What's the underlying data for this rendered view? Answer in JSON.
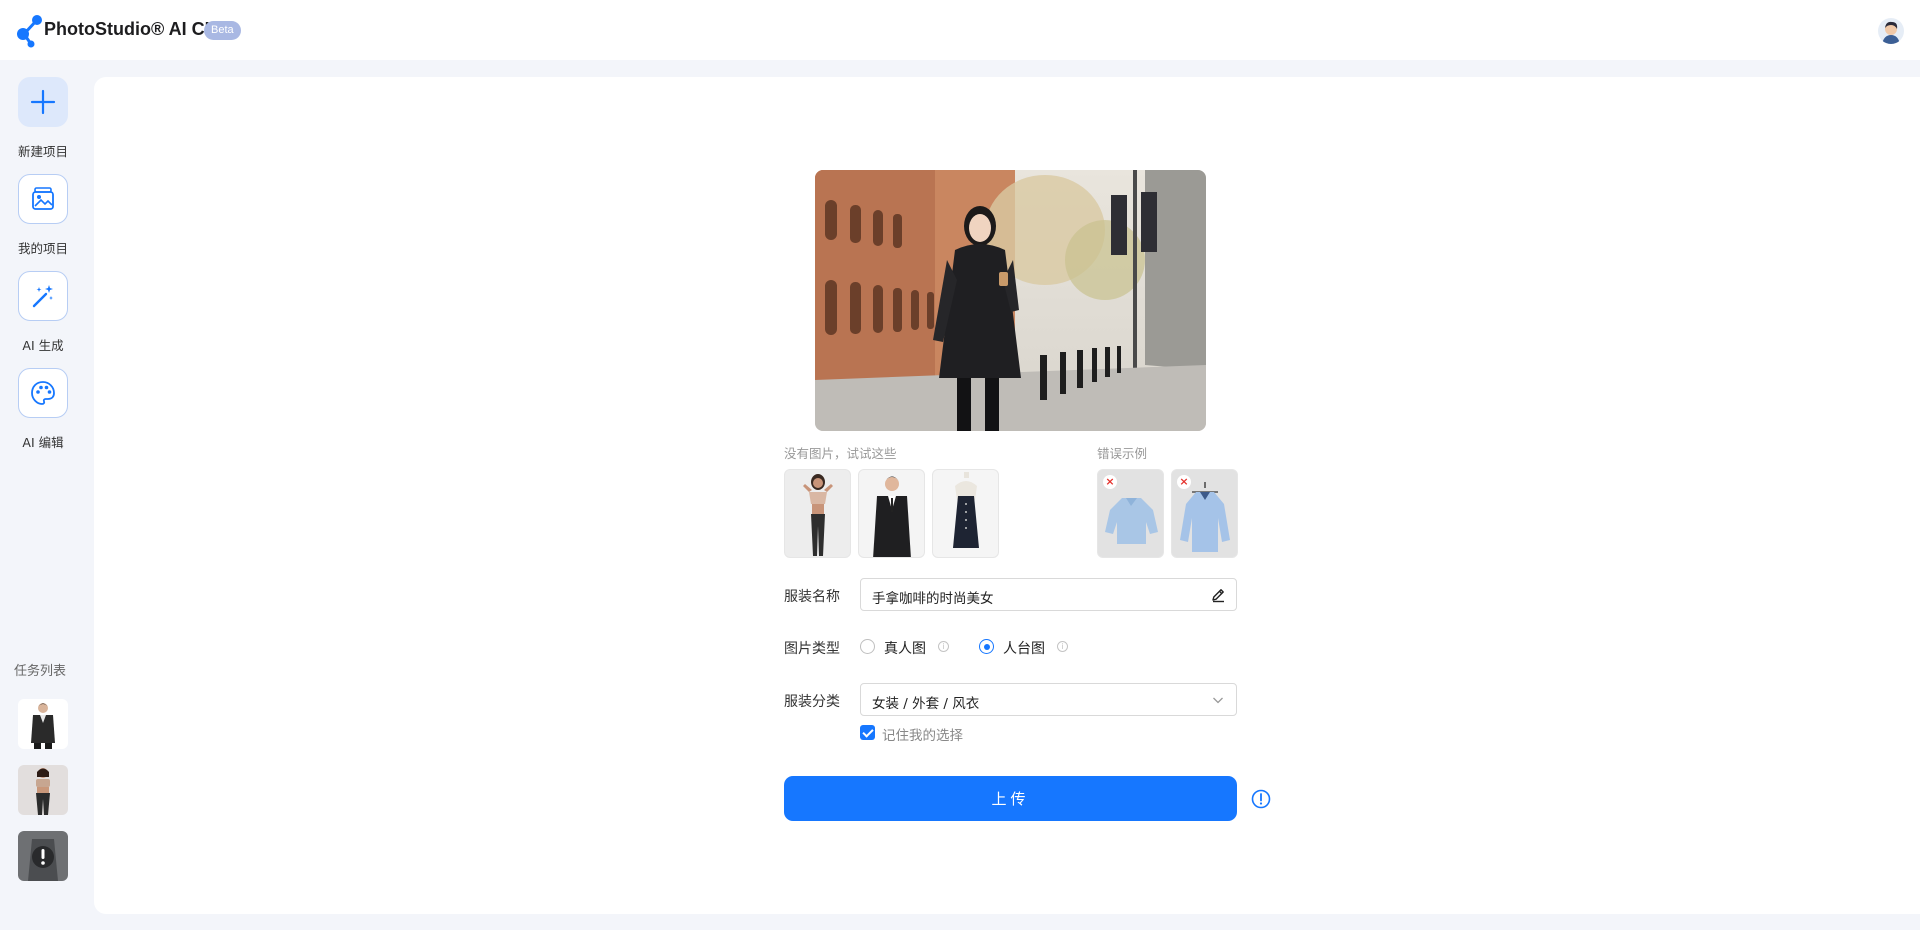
{
  "header": {
    "brand": "PhotoStudio® AI CL",
    "badge": "Beta"
  },
  "sidebar": {
    "items": [
      {
        "label": "新建项目",
        "icon": "plus-icon"
      },
      {
        "label": "我的项目",
        "icon": "image-gallery-icon"
      },
      {
        "label": "AI 生成",
        "icon": "magic-wand-icon"
      },
      {
        "label": "AI 编辑",
        "icon": "palette-icon"
      }
    ],
    "task_list_title": "任务列表"
  },
  "samples": {
    "hint": "没有图片，试试这些",
    "items": [
      "female-model-sample",
      "male-suit-sample",
      "mannequin-dress-sample"
    ]
  },
  "bad_examples": {
    "hint": "错误示例",
    "mark": "×"
  },
  "form": {
    "name_label": "服装名称",
    "name_value": "手拿咖啡的时尚美女",
    "type_label": "图片类型",
    "type_options": [
      "真人图",
      "人台图"
    ],
    "type_selected": "人台图",
    "category_label": "服装分类",
    "category_value": "女装 / 外套 / 风衣",
    "remember_label": "记住我的选择",
    "remember_checked": true,
    "upload_label": "上传"
  },
  "colors": {
    "accent": "#1677ff",
    "badge": "#a9b8e3",
    "error": "#e5322d"
  }
}
